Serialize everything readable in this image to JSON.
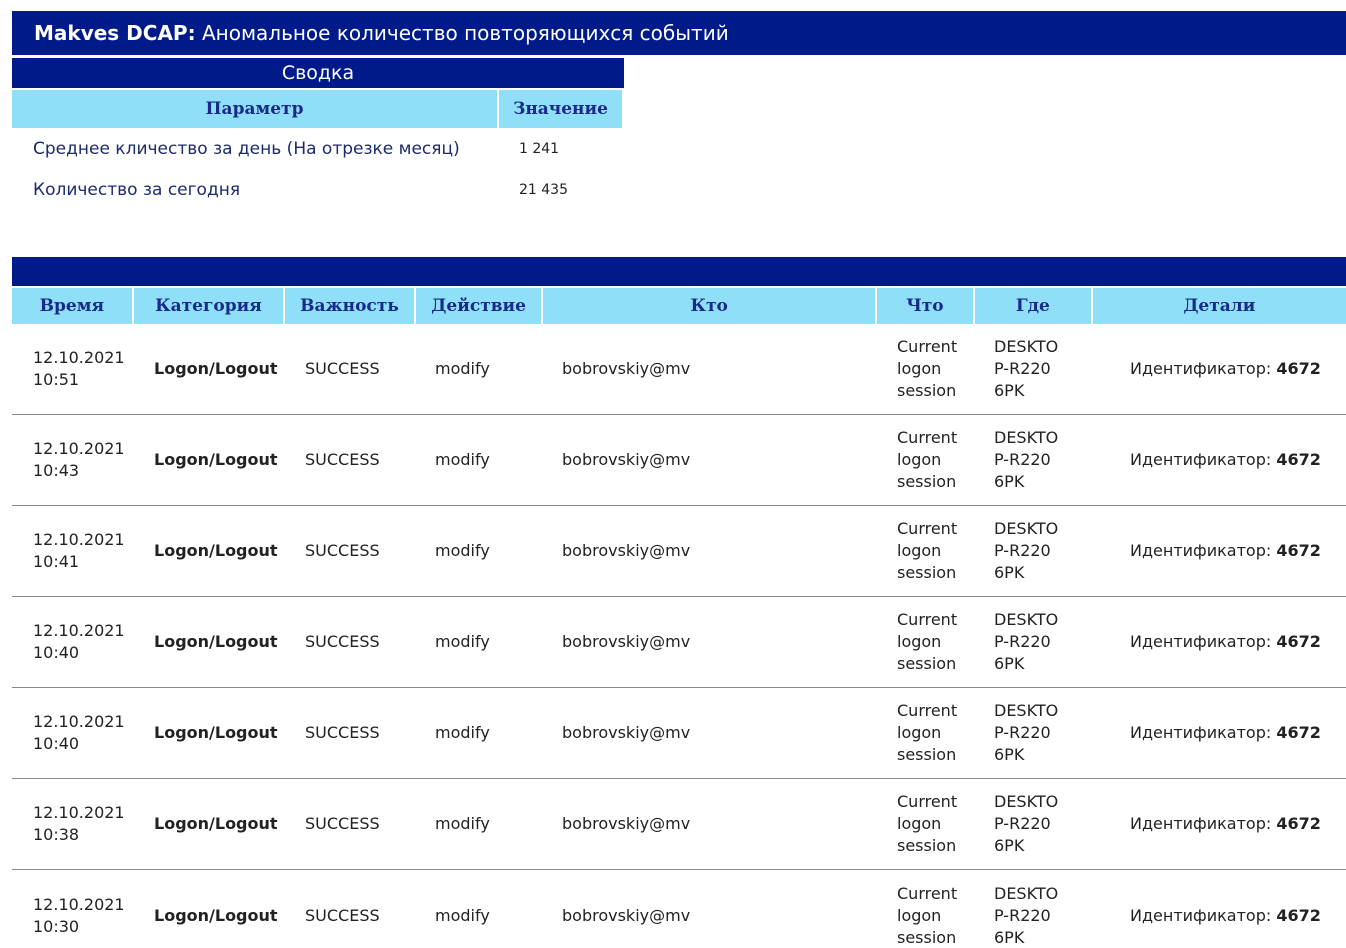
{
  "header": {
    "brand": "Makves DCAP:",
    "title": " Аномальное количество повторяющихся событий"
  },
  "summary": {
    "caption": "Сводка",
    "columns": [
      "Параметр",
      "Значение"
    ],
    "rows": [
      {
        "param": "Среднее кличество за день (На отрезке месяц)",
        "value": "1 241"
      },
      {
        "param": "Количество за сегодня",
        "value": "21 435"
      }
    ]
  },
  "events": {
    "columns": [
      "Время",
      "Категория",
      "Важность",
      "Действие",
      "Кто",
      "Что",
      "Где",
      "Детали"
    ],
    "details_label": "Идентификатор: ",
    "rows": [
      {
        "date": "12.10.2021",
        "time": "10:51",
        "category": "Logon/Logout",
        "severity": "SUCCESS",
        "action": "modify",
        "who": "bobrovskiy@mv",
        "what": "Current logon session",
        "where": "DESKTOP-R2206PK",
        "id": "4672"
      },
      {
        "date": "12.10.2021",
        "time": "10:43",
        "category": "Logon/Logout",
        "severity": "SUCCESS",
        "action": "modify",
        "who": "bobrovskiy@mv",
        "what": "Current logon session",
        "where": "DESKTOP-R2206PK",
        "id": "4672"
      },
      {
        "date": "12.10.2021",
        "time": "10:41",
        "category": "Logon/Logout",
        "severity": "SUCCESS",
        "action": "modify",
        "who": "bobrovskiy@mv",
        "what": "Current logon session",
        "where": "DESKTOP-R2206PK",
        "id": "4672"
      },
      {
        "date": "12.10.2021",
        "time": "10:40",
        "category": "Logon/Logout",
        "severity": "SUCCESS",
        "action": "modify",
        "who": "bobrovskiy@mv",
        "what": "Current logon session",
        "where": "DESKTOP-R2206PK",
        "id": "4672"
      },
      {
        "date": "12.10.2021",
        "time": "10:40",
        "category": "Logon/Logout",
        "severity": "SUCCESS",
        "action": "modify",
        "who": "bobrovskiy@mv",
        "what": "Current logon session",
        "where": "DESKTOP-R2206PK",
        "id": "4672"
      },
      {
        "date": "12.10.2021",
        "time": "10:38",
        "category": "Logon/Logout",
        "severity": "SUCCESS",
        "action": "modify",
        "who": "bobrovskiy@mv",
        "what": "Current logon session",
        "where": "DESKTOP-R2206PK",
        "id": "4672"
      },
      {
        "date": "12.10.2021",
        "time": "10:30",
        "category": "Logon/Logout",
        "severity": "SUCCESS",
        "action": "modify",
        "who": "bobrovskiy@mv",
        "what": "Current logon session",
        "where": "DESKTOP-R2206PK",
        "id": "4672"
      }
    ]
  }
}
